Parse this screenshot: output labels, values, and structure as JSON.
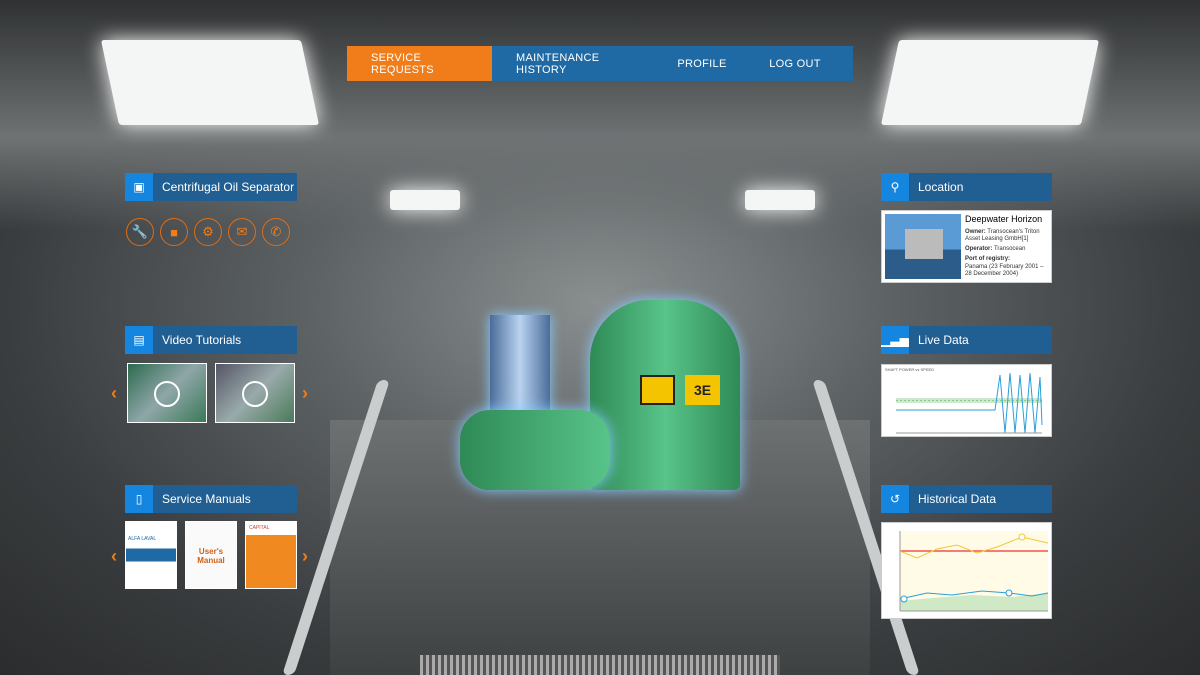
{
  "nav": [
    {
      "label": "SERVICE  REQUESTS",
      "active": true
    },
    {
      "label": "MAINTENANCE  HISTORY"
    },
    {
      "label": "PROFILE"
    },
    {
      "label": "LOG OUT"
    }
  ],
  "equipment": {
    "title": "Centrifugal Oil Separator",
    "actions": [
      "wrench-icon",
      "book-icon",
      "gears-icon",
      "mail-icon",
      "phone-icon"
    ]
  },
  "video": {
    "title": "Video Tutorials"
  },
  "manuals": {
    "title": "Service Manuals",
    "items": [
      "ALFA LAVAL",
      "User's Manual",
      "CAPITAL"
    ]
  },
  "location": {
    "title": "Location",
    "name": "Deepwater Horizon",
    "owner_label": "Owner:",
    "owner": "Transocean's Triton Asset Leasing GmbH[1]",
    "operator_label": "Operator:",
    "operator": "Transocean",
    "port_label": "Port of registry:",
    "port": "Panama (23 February 2001 – 28 December 2004)"
  },
  "live": {
    "title": "Live Data",
    "chart_title": "SHAFT POWER vs SPEED"
  },
  "historical": {
    "title": "Historical Data"
  },
  "colors": {
    "accent": "#f07d1a",
    "nav": "#1f6aa5",
    "header": "#215f92",
    "icon_bg": "#1586e0"
  }
}
